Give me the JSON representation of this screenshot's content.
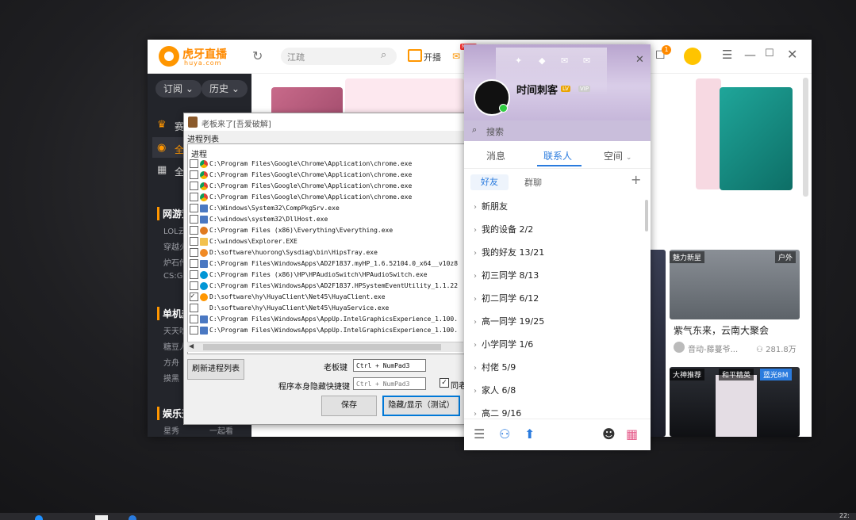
{
  "huya": {
    "brand": "虎牙直播",
    "brand_sub": "huya.com",
    "search_placeholder": "江疏",
    "broadcast_label": "开播",
    "new_badge": "NEW",
    "notif_count": "1",
    "sidebar": {
      "subscribe_btn": "订阅",
      "history_btn": "历史",
      "nav": [
        {
          "label": "赛",
          "icon": "trophy-icon"
        },
        {
          "label": "全",
          "icon": "huya-icon"
        },
        {
          "label": "全",
          "icon": "grid-icon"
        }
      ],
      "categories": [
        {
          "title": "网游竞",
          "items": [
            "LOL云",
            "穿越火",
            "炉石传",
            "CS:GO"
          ]
        },
        {
          "title": "单机热",
          "items": [
            "天天吃",
            "糖豆人",
            "方舟",
            "摸黑"
          ]
        },
        {
          "title": "娱乐天",
          "items": [
            "星秀",
            "一起看"
          ]
        }
      ]
    },
    "cards": [
      {
        "tag": "魅力新星",
        "tag2": "户外",
        "title": "紫气东来，云南大聚会",
        "author": "音动-藤蔓爷...",
        "viewers": "281.8万"
      },
      {
        "tag": "大神推荐",
        "tag2": "和平精英",
        "tag3": "蓝光8M"
      }
    ],
    "colors": {
      "accent": "#ff9600",
      "sidebar_bg": "#23252b"
    }
  },
  "hider": {
    "title": "老板来了[吾爱破解]",
    "group_label": "进程列表",
    "list_header": "进程",
    "processes": [
      {
        "path": "C:\\Program Files\\Google\\Chrome\\Application\\chrome.exe",
        "icon": "chrome-icon",
        "checked": false
      },
      {
        "path": "C:\\Program Files\\Google\\Chrome\\Application\\chrome.exe",
        "icon": "chrome-icon",
        "checked": false
      },
      {
        "path": "C:\\Program Files\\Google\\Chrome\\Application\\chrome.exe",
        "icon": "chrome-icon",
        "checked": false
      },
      {
        "path": "C:\\Program Files\\Google\\Chrome\\Application\\chrome.exe",
        "icon": "chrome-icon",
        "checked": false
      },
      {
        "path": "C:\\Windows\\System32\\CompPkgSrv.exe",
        "icon": "exe-icon",
        "checked": false
      },
      {
        "path": "C:\\windows\\system32\\DllHost.exe",
        "icon": "exe-icon",
        "checked": false
      },
      {
        "path": "C:\\Program Files (x86)\\Everything\\Everything.exe",
        "icon": "search-tool-icon",
        "checked": false
      },
      {
        "path": "C:\\windows\\Explorer.EXE",
        "icon": "folder-icon",
        "checked": false
      },
      {
        "path": "D:\\software\\huorong\\Sysdiag\\bin\\HipsTray.exe",
        "icon": "shield-icon",
        "checked": false
      },
      {
        "path": "C:\\Program Files\\WindowsApps\\AD2F1837.myHP_1.6.52104.0_x64__v10z8",
        "icon": "exe-icon",
        "checked": false
      },
      {
        "path": "C:\\Program Files (x86)\\HP\\HPAudioSwitch\\HPAudioSwitch.exe",
        "icon": "hp-icon",
        "checked": false
      },
      {
        "path": "C:\\Program Files\\WindowsApps\\AD2F1837.HPSystemEventUtility_1.1.22",
        "icon": "hp-icon",
        "checked": false
      },
      {
        "path": "D:\\software\\hy\\HuyaClient\\Net45\\HuyaClient.exe",
        "icon": "huya-icon",
        "checked": true
      },
      {
        "path": "D:\\software\\hy\\HuyaClient\\Net45\\HuyaService.exe",
        "icon": "blank-icon",
        "checked": false
      },
      {
        "path": "C:\\Program Files\\WindowsApps\\AppUp.IntelGraphicsExperience_1.100.",
        "icon": "exe-icon",
        "checked": false
      },
      {
        "path": "C:\\Program Files\\WindowsApps\\AppUp.IntelGraphicsExperience_1.100.",
        "icon": "exe-icon",
        "checked": false
      }
    ],
    "refresh_btn": "刷新进程列表",
    "boss_key_label": "老板键",
    "boss_key_value": "Ctrl + NumPad3",
    "self_hide_label": "程序本身隐藏快捷键",
    "self_hide_value": "Ctrl + NumPad3",
    "same_label": "同老",
    "save_btn": "保存",
    "toggle_btn": "隐藏/显示（测试）"
  },
  "qq": {
    "nickname": "时间刺客",
    "level_badge": "LV",
    "vip_badge": "VIP",
    "search_placeholder": "搜索",
    "tabs": [
      "消息",
      "联系人",
      "空间"
    ],
    "sub_tabs": [
      "好友",
      "群聊"
    ],
    "groups": [
      "新朋友",
      "我的设备 2/2",
      "我的好友 13/21",
      "初三同学 8/13",
      "初二同学 6/12",
      "高一同学 19/25",
      "小学同学 1/6",
      "村佬 5/9",
      "家人 6/8",
      "高二 9/16"
    ],
    "colors": {
      "accent": "#2a7bde"
    }
  },
  "taskbar": {
    "clock": "22:"
  }
}
